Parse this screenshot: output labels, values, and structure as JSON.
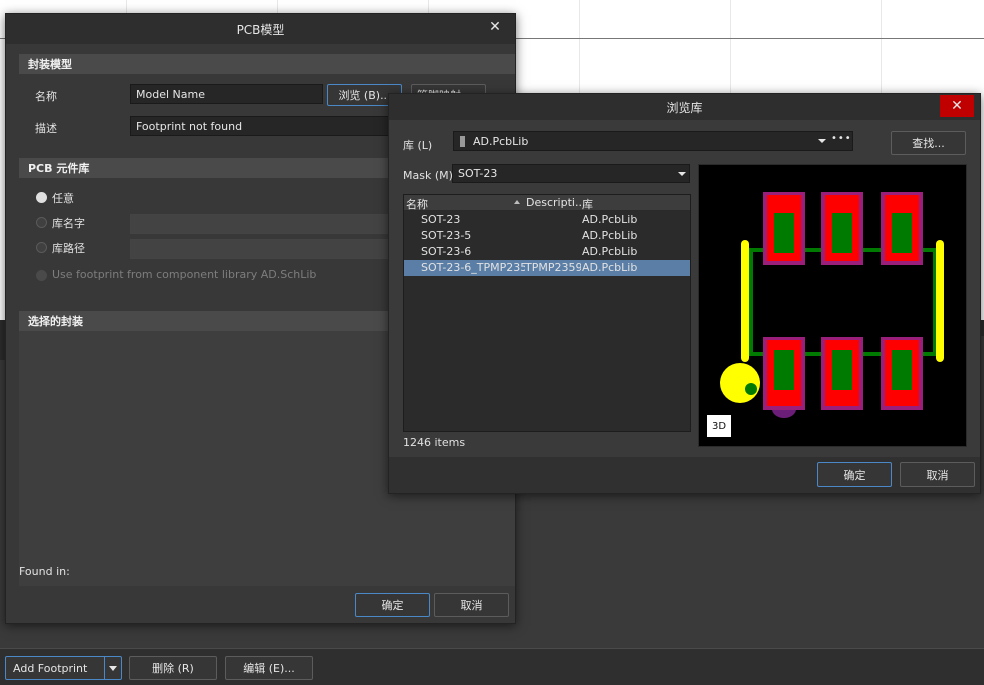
{
  "main_dialog": {
    "title": "PCB模型",
    "footprint_section": "封装模型",
    "name_label": "名称",
    "name_value": "Model Name",
    "browse_button": "浏览 (B)...",
    "pin_map_button": "管脚映射...",
    "desc_label": "描述",
    "desc_value": "Footprint not found",
    "library_section": "PCB 元件库",
    "radio_any": "任意",
    "radio_lib_name": "库名字",
    "radio_lib_path": "库路径",
    "use_footprint_label": "Use footprint from component library AD.SchLib",
    "selected_section": "选择的封装",
    "found_in_label": "Found in:",
    "ok_button": "确定",
    "cancel_button": "取消"
  },
  "browse_dialog": {
    "title": "浏览库",
    "lib_label": "库 (L)",
    "lib_value": "AD.PcbLib",
    "find_button": "查找...",
    "mask_label": "Mask (M)",
    "mask_value": "SOT-23",
    "columns": {
      "name": "名称",
      "description": "Descripti...",
      "library": "库"
    },
    "rows": [
      {
        "name": "SOT-23",
        "description": "",
        "library": "AD.PcbLib"
      },
      {
        "name": "SOT-23-5",
        "description": "",
        "library": "AD.PcbLib"
      },
      {
        "name": "SOT-23-6",
        "description": "",
        "library": "AD.PcbLib"
      },
      {
        "name": "SOT-23-6_TPMP2359",
        "description": "TPMP2359",
        "library": "AD.PcbLib"
      }
    ],
    "item_count": "1246 items",
    "preview_3d_button": "3D",
    "ok_button": "确定",
    "cancel_button": "取消"
  },
  "bottom_bar": {
    "add_footprint_button": "Add Footprint",
    "delete_button": "删除 (R)",
    "edit_button": "编辑 (E)..."
  },
  "colors": {
    "accent": "#4a88c7",
    "selected_row": "#5a7ea6",
    "close_red": "#c00000",
    "pad_red": "#ff0000",
    "pad_green": "#007a00",
    "silkscreen_yellow": "#ffff00",
    "outline_magenta": "#9a1f7a"
  }
}
